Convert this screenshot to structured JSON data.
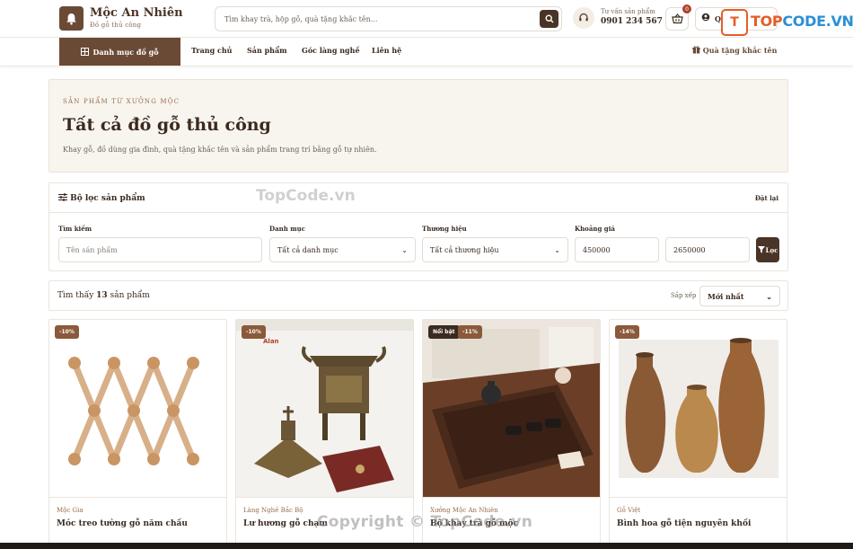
{
  "header": {
    "brand_name": "Mộc An Nhiên",
    "brand_tagline": "Đồ gỗ thủ công",
    "search_placeholder": "Tìm khay trà, hộp gỗ, quà tặng khắc tên...",
    "hotline_label": "Tư vấn sản phẩm",
    "hotline_number": "0901 234 567",
    "cart_count": "0",
    "account_label": "Q"
  },
  "watermark": {
    "logo_letter": "T",
    "brand_a": "TOP",
    "brand_b": "CODE.VN",
    "center": "TopCode.vn",
    "copyright": "Copyright © TopCode.vn"
  },
  "nav": {
    "category_label": "Danh mục đồ gỗ",
    "links": [
      "Trang chủ",
      "Sản phẩm",
      "Góc làng nghề",
      "Liên hệ"
    ],
    "gift_label": "Quà tặng khắc tên"
  },
  "hero": {
    "eyebrow": "Sản phẩm từ xưởng mộc",
    "title": "Tất cả đồ gỗ thủ công",
    "description": "Khay gỗ, đồ dùng gia đình, quà tặng khắc tên và sản phẩm trang trí bằng gỗ tự nhiên."
  },
  "filter": {
    "title": "Bộ lọc sản phẩm",
    "reset_label": "Đặt lại",
    "search_label": "Tìm kiếm",
    "search_placeholder": "Tên sản phẩm",
    "category_label": "Danh mục",
    "category_value": "Tất cả danh mục",
    "brand_label": "Thương hiệu",
    "brand_value": "Tất cả thương hiệu",
    "price_label": "Khoảng giá",
    "price_min": "450000",
    "price_max": "2650000",
    "apply_label": "Lọc"
  },
  "results": {
    "prefix": "Tìm thấy",
    "count": "13",
    "suffix": "sản phẩm",
    "sort_label": "Sắp xếp",
    "sort_value": "Mới nhất"
  },
  "products": [
    {
      "badges": [
        "-10%"
      ],
      "brand": "Mộc Gia",
      "name": "Móc treo tường gỗ năm chấu"
    },
    {
      "badges": [
        "-10%"
      ],
      "brand": "Làng Nghề Bắc Bộ",
      "name": "Lư hương gỗ chạm",
      "image_text": "Alan"
    },
    {
      "badges": [
        "Nổi bật",
        "-11%"
      ],
      "brand": "Xưởng Mộc An Nhiên",
      "name": "Bộ khay trà gỗ mộc"
    },
    {
      "badges": [
        "-14%"
      ],
      "brand": "Gỗ Việt",
      "name": "Bình hoa gỗ tiện nguyên khối"
    }
  ],
  "colors": {
    "primary": "#6b4a35",
    "dark": "#4a3426",
    "cream": "#f8f4ee",
    "accent_text": "#9a6e4c",
    "watermark_orange": "#e55d27",
    "watermark_blue": "#2b8fd6"
  }
}
